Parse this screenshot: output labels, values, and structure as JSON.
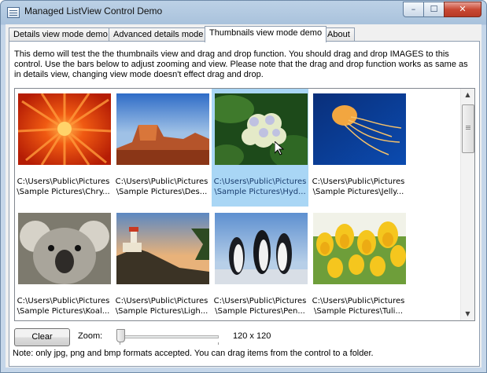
{
  "window": {
    "title": "Managed ListView Control Demo",
    "controls": {
      "minimize": "–",
      "maximize": "☐",
      "close": "✕"
    }
  },
  "tabs": [
    {
      "label": "Details view mode demo",
      "active": false
    },
    {
      "label": "Advanced details mode",
      "active": false
    },
    {
      "label": "Thumbnails view mode demo",
      "active": true
    },
    {
      "label": "About",
      "active": false
    }
  ],
  "description": "This demo will test the the thumbnails view and drag and drop function. You should drag and drop IMAGES to this control. Use the bars below to adjust zooming and view. Please note that the drag and drop function works as same as in details view, changing view mode doesn't effect drag and drop.",
  "thumbnails": [
    {
      "line1": "C:\\Users\\Public\\Pictures",
      "line2": "\\Sample Pictures\\Chry...",
      "image": "chrysanthemum",
      "selected": false
    },
    {
      "line1": "C:\\Users\\Public\\Pictures",
      "line2": "\\Sample Pictures\\Des...",
      "image": "desert",
      "selected": false
    },
    {
      "line1": "C:\\Users\\Public\\Pictures",
      "line2": "\\Sample Pictures\\Hyd...",
      "image": "hydrangeas",
      "selected": true
    },
    {
      "line1": "C:\\Users\\Public\\Pictures",
      "line2": "\\Sample Pictures\\Jelly...",
      "image": "jellyfish",
      "selected": false
    },
    {
      "line1": "C:\\Users\\Public\\Pictures",
      "line2": "\\Sample Pictures\\Koal...",
      "image": "koala",
      "selected": false
    },
    {
      "line1": "C:\\Users\\Public\\Pictures",
      "line2": "\\Sample Pictures\\Ligh...",
      "image": "lighthouse",
      "selected": false
    },
    {
      "line1": "C:\\Users\\Public\\Pictures",
      "line2": "\\Sample Pictures\\Pen...",
      "image": "penguins",
      "selected": false
    },
    {
      "line1": "C:\\Users\\Public\\Pictures",
      "line2": "\\Sample Pictures\\Tuli...",
      "image": "tulips",
      "selected": false
    }
  ],
  "scrollbar": {
    "up": "▲",
    "down": "▼"
  },
  "controls": {
    "clear_label": "Clear",
    "zoom_label": "Zoom:",
    "zoom_value": "120 x 120",
    "zoom_level": 0
  },
  "note": "Note: only jpg, png and bmp formats accepted. You can drag items from the control to a folder.",
  "colors": {
    "selection": "#a9d6f5",
    "title_bar": "#bcd1e6",
    "close_button": "#c94934"
  }
}
